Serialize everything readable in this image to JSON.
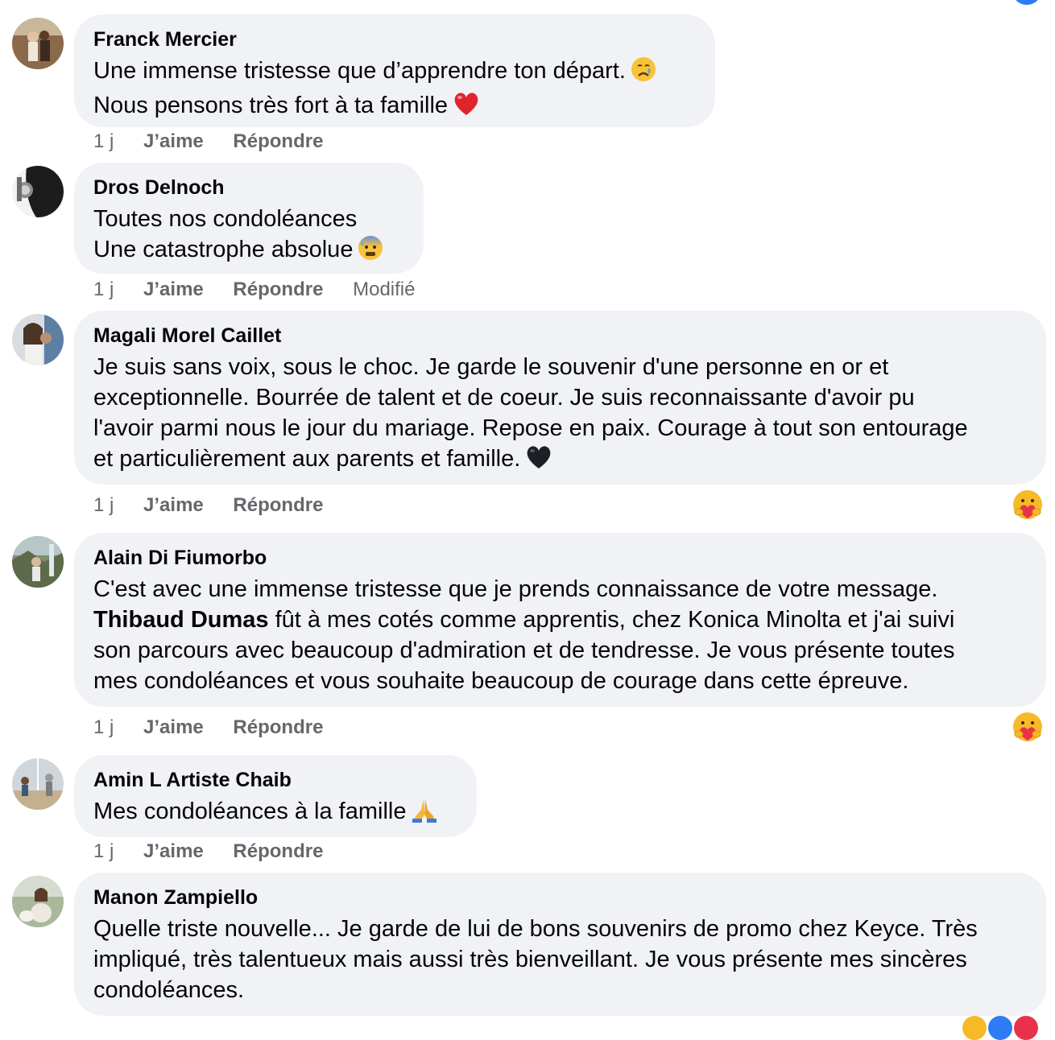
{
  "comments": [
    {
      "author": "Franck Mercier",
      "lines": [
        "Une immense tristesse que d’apprendre ton départ.",
        "Nous pensons très fort à ta famille"
      ],
      "emoji": [
        "crying-face-icon",
        "red-heart-icon"
      ],
      "time": "1 j",
      "like": "J’aime",
      "reply": "Répondre"
    },
    {
      "author": "Dros Delnoch",
      "lines": [
        "Toutes nos condoléances",
        "Une catastrophe absolue"
      ],
      "emoji": [
        "anxious-sweat-face-icon"
      ],
      "time": "1 j",
      "like": "J’aime",
      "reply": "Répondre",
      "edited": "Modifié"
    },
    {
      "author": "Magali Morel Caillet",
      "lines": [
        "Je suis sans voix, sous le choc. Je garde le souvenir d'une personne en or et",
        "exceptionnelle. Bourrée de talent et de coeur. Je suis reconnaissante d'avoir pu",
        "l'avoir parmi nous le jour du mariage. Repose en paix. Courage à tout son entourage",
        "et particulièrement aux parents et famille."
      ],
      "emoji": [
        "black-heart-icon"
      ],
      "time": "1 j",
      "like": "J’aime",
      "reply": "Répondre",
      "reaction": "care-reaction-icon"
    },
    {
      "author": "Alain Di Fiumorbo",
      "line1": "C'est avec une immense tristesse que je prends connaissance de votre message.",
      "mention": "Thibaud Dumas",
      "line2_rest": " fût à mes cotés comme apprentis, chez Konica Minolta et j'ai suivi",
      "line3": "son parcours avec beaucoup d'admiration et de tendresse. Je vous présente toutes",
      "line4": "mes condoléances et vous souhaite beaucoup de courage dans cette épreuve.",
      "time": "1 j",
      "like": "J’aime",
      "reply": "Répondre",
      "reaction": "care-reaction-icon"
    },
    {
      "author": "Amin L Artiste Chaib",
      "lines": [
        "Mes condoléances à la famille"
      ],
      "emoji": [
        "folded-hands-icon"
      ],
      "time": "1 j",
      "like": "J’aime",
      "reply": "Répondre"
    },
    {
      "author": "Manon Zampiello",
      "lines": [
        "Quelle triste nouvelle... Je garde de lui de bons souvenirs de promo chez Keyce. Très",
        "impliqué, très talentueux mais aussi très bienveillant. Je vous présente mes sincères",
        "condoléances."
      ]
    }
  ],
  "colors": {
    "bubble": "#f0f2f5",
    "meta_text": "#65676b",
    "text": "#050505",
    "like_blue": "#2d7cf6"
  }
}
